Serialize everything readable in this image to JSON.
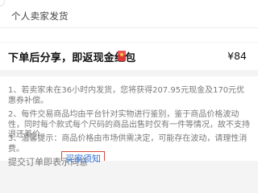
{
  "seller": {
    "type_label": "个人卖家发货"
  },
  "cashback": {
    "text": "下单后分享，即返现金红包",
    "icon": "red-packet-icon",
    "amount": "¥84"
  },
  "notes": [
    "1、若卖家未在36小时内发货，您将获得207.95元现金及170元优惠券补偿。",
    "2、每件交易商品均由平台针对实物进行鉴别，鉴于商品价格波动性，同时每个款式每个尺码的商品出售时仅有一件等情况，故不支持退还差价。",
    "3、温馨提示：商品价格由市场供需决定，可能存在波动，请理性消费。"
  ],
  "footer": {
    "text_partial": "提交订单即表示同意",
    "link_partial": "买家须知"
  },
  "colors": {
    "accent_red": "#d34a3c",
    "link_blue": "#2f6fd6",
    "note_gray": "#7a7a7a"
  }
}
